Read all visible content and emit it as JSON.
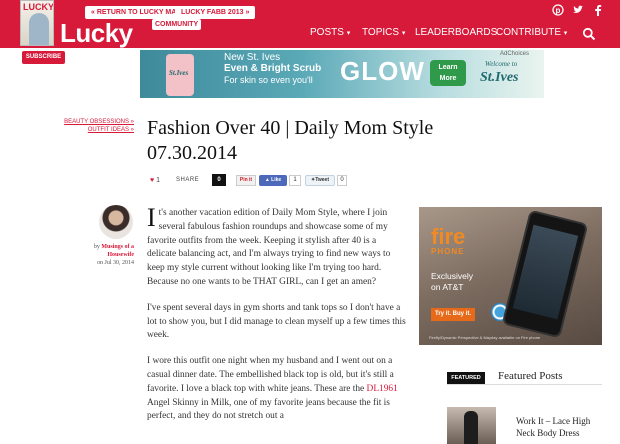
{
  "header": {
    "logo": "Lucky",
    "community_tag": "COMMUNITY",
    "magazine_cover_title": "LUCKY",
    "subscribe_label": "SUBSCRIBE",
    "top_links": [
      "« RETURN TO LUCKY MAG",
      "LUCKY FABB 2013 »"
    ],
    "social_icons": [
      "pinterest-icon",
      "twitter-icon",
      "facebook-icon"
    ],
    "nav": [
      {
        "label": "POSTS",
        "caret": "▾"
      },
      {
        "label": "TOPICS",
        "caret": "▾"
      },
      {
        "label": "LEADERBOARDS",
        "caret": ""
      },
      {
        "label": "CONTRIBUTE",
        "caret": "▾"
      }
    ],
    "search_icon": "search-icon",
    "brand_color": "#d7193a"
  },
  "ad_banner": {
    "line1": "New St. Ives",
    "line2": "Even & Bright Scrub",
    "line3": "For skin so even you'll",
    "glow": "GLOW",
    "cta": "Learn More",
    "adchoices": "AdChoices",
    "welcome": "Welcome to",
    "brand": "St.Ives",
    "tube_brand": "St.Ives"
  },
  "breadcrumbs": [
    "BEAUTY OBSESSIONS »",
    "OUTFIT IDEAS »"
  ],
  "post": {
    "title": "Fashion Over 40 | Daily Mom Style 07.30.2014",
    "likes": "1",
    "share_label": "SHARE",
    "share_count": "0",
    "pinit_label": "Pin it",
    "fb_like_label": "Like",
    "fb_count": "1",
    "tweet_label": "Tweet",
    "tweet_count": "0",
    "author_by": "by",
    "author_name": "Musings of a Housewife",
    "author_on": "on",
    "date": "Jul 30, 2014",
    "drop_cap": "I",
    "para1": "t's another vacation edition of Daily Mom Style, where I join several fabulous fashion roundups and showcase some of my favorite outfits from the week. Keeping it stylish after 40 is a delicate balancing act, and I'm always trying to find new ways to keep my style current without looking like I'm trying too hard. Because no one wants to be THAT GIRL, can I get an amen?",
    "para2": "I've spent several days in gym shorts and tank tops so I don't have a lot to show you, but I did manage to clean myself up a few times this week.",
    "para3_a": "I wore this outfit one night when my husband and I went out on a casual dinner date. The embellished black top is old, but it's still a favorite. I love a black top with white jeans. These are the ",
    "para3_link": "DL1961",
    "para3_b": " Angel Skinny in Milk, one of my favorite jeans because the fit is perfect, and they do not stretch out a"
  },
  "side_ad": {
    "fire": "fire",
    "phone": "PHONE",
    "exclusive": "Exclusively",
    "on_att": "on AT&T",
    "cta": "Try it. Buy it.",
    "fine_print": "Firefly/Dynamic Perspective & Mayday available on Fire phone"
  },
  "featured": {
    "badge": "FEATURED",
    "heading": "Featured Posts",
    "item_title": "Work It – Lace High Neck Body Dress"
  }
}
